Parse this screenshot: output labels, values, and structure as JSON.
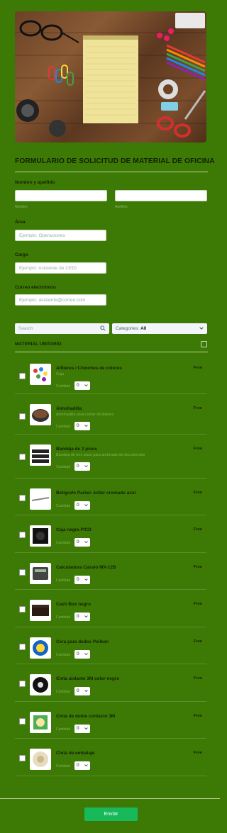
{
  "form": {
    "title": "FORMULARIO DE SOLICITUD DE MATERIAL DE OFICINA",
    "fields": {
      "name": {
        "label": "Nombre y apellido",
        "first_sub": "Nombre",
        "last_sub": "Apellido"
      },
      "area": {
        "label": "Área",
        "placeholder": "Ejemplo: Operaciones"
      },
      "cargo": {
        "label": "Cargo",
        "placeholder": "Ejemplo: Asistente de CEDI"
      },
      "email": {
        "label": "Correo electrónico",
        "placeholder": "Ejemplo: asistente@correo.com"
      }
    },
    "search_placeholder": "Search",
    "categories_label": "Categories:",
    "categories_value": "All",
    "section_title": "MATERIAL UNITARIO",
    "submit_label": "Enviar"
  },
  "products": [
    {
      "name": "Alfileres / Chinches de colores",
      "desc": "Caja",
      "qty_label": "Cantidad",
      "qty": "0",
      "price": "Free",
      "icon": "pushpins-icon"
    },
    {
      "name": "Almohadilla",
      "desc": "Almohadilla para contar de billetes",
      "qty_label": "Cantidad",
      "qty": "0",
      "price": "Free",
      "icon": "ink-pad-icon"
    },
    {
      "name": "Bandeja de 3 pisos",
      "desc": "Bandeja de tres pisos para archivado de documentos",
      "qty_label": "Cantidad",
      "qty": "0",
      "price": "Free",
      "icon": "tray-icon"
    },
    {
      "name": "Bolígrafo Parker Jotter cromado azul",
      "desc": "",
      "qty_label": "Cantidad",
      "qty": "0",
      "price": "Free",
      "icon": "pen-icon"
    },
    {
      "name": "Caja negra P/CD",
      "desc": "",
      "qty_label": "Cantidad",
      "qty": "0",
      "price": "Free",
      "icon": "cd-case-icon"
    },
    {
      "name": "Calculadora Cassio MX-12B",
      "desc": "",
      "qty_label": "Cantidad",
      "qty": "0",
      "price": "Free",
      "icon": "calculator-icon"
    },
    {
      "name": "Cash Box negro",
      "desc": "",
      "qty_label": "Cantidad",
      "qty": "0",
      "price": "Free",
      "icon": "cash-box-icon"
    },
    {
      "name": "Cera para dedos Pelikan",
      "desc": "",
      "qty_label": "Cantidad",
      "qty": "0",
      "price": "Free",
      "icon": "finger-wax-icon"
    },
    {
      "name": "Cinta aislante 3M color negro",
      "desc": "",
      "qty_label": "Cantidad",
      "qty": "0",
      "price": "Free",
      "icon": "insulating-tape-icon"
    },
    {
      "name": "Cinta de doble contacto 3M",
      "desc": "",
      "qty_label": "Cantidad",
      "qty": "0",
      "price": "Free",
      "icon": "double-tape-icon"
    },
    {
      "name": "Cinta de embalaje",
      "desc": "",
      "qty_label": "Cantidad",
      "qty": "0",
      "price": "Free",
      "icon": "packing-tape-icon"
    }
  ],
  "colors": {
    "background": "#3d7a05",
    "submit": "#18b95a"
  }
}
